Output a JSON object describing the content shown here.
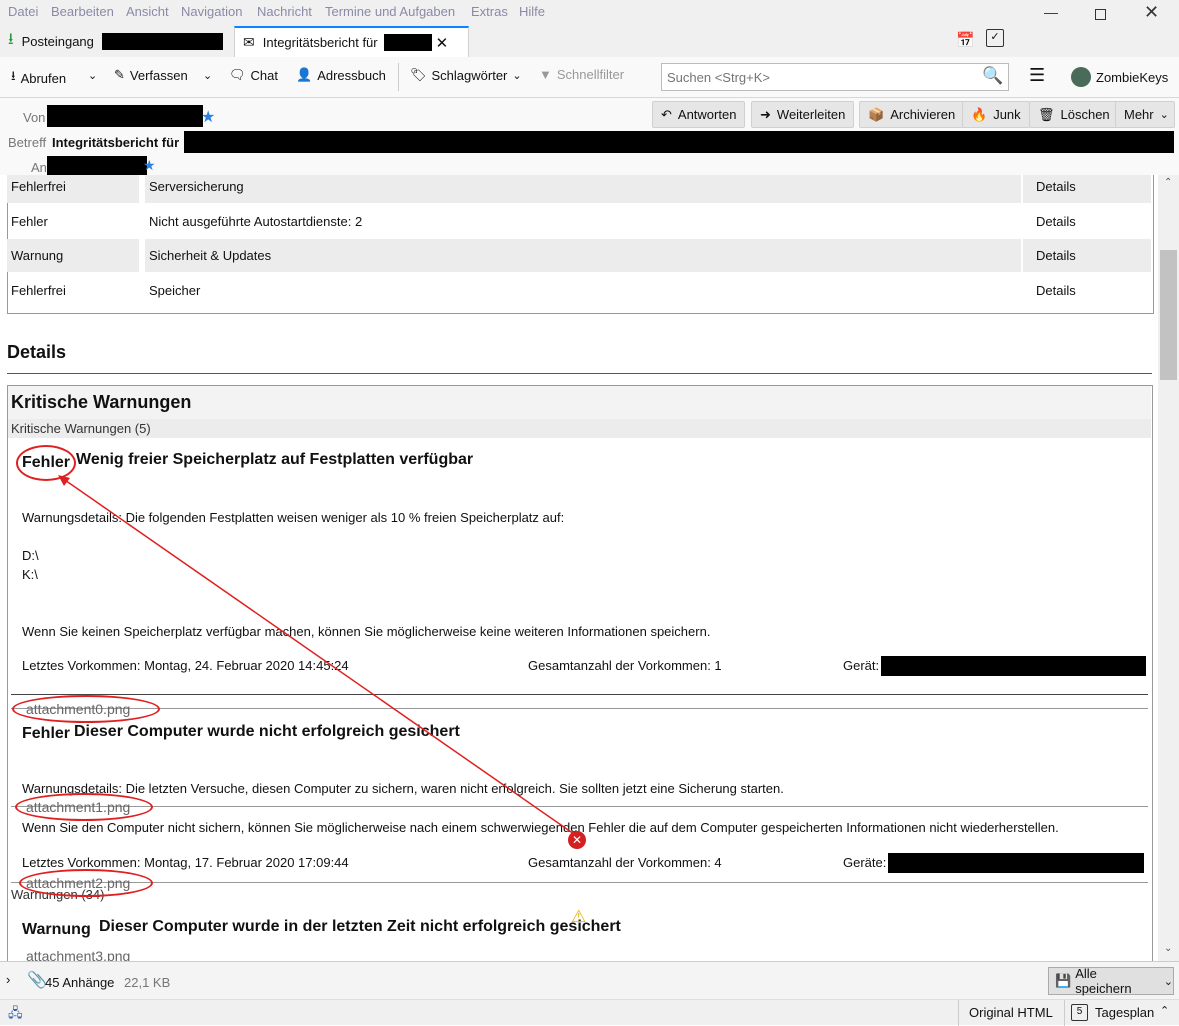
{
  "menu": [
    "Datei",
    "Bearbeiten",
    "Ansicht",
    "Navigation",
    "Nachricht",
    "Termine und Aufgaben",
    "Extras",
    "Hilfe"
  ],
  "tabs": [
    {
      "label": "Posteingang"
    },
    {
      "label": "Integritätsbericht für"
    }
  ],
  "toolbar": {
    "fetch": "Abrufen",
    "compose": "Verfassen",
    "chat": "Chat",
    "addressbook": "Adressbuch",
    "tags": "Schlagwörter",
    "quickfilter": "Schnellfilter",
    "search_placeholder": "Suchen <Strg+K>",
    "account": "ZombieKeys"
  },
  "header": {
    "from_label": "Von",
    "subject_label": "Betreff",
    "subject": "Integritätsbericht für",
    "to_label": "An",
    "buttons": {
      "reply": "Antworten",
      "forward": "Weiterleiten",
      "archive": "Archivieren",
      "junk": "Junk",
      "delete": "Löschen",
      "more": "Mehr"
    }
  },
  "summary_rows": [
    {
      "status": "Fehlerfrei",
      "name": "Serversicherung",
      "link": "Details"
    },
    {
      "status": "Fehler",
      "name": "Nicht ausgeführte Autostartdienste: 2",
      "link": "Details"
    },
    {
      "status": "Warnung",
      "name": "Sicherheit & Updates",
      "link": "Details"
    },
    {
      "status": "Fehlerfrei",
      "name": "Speicher",
      "link": "Details"
    }
  ],
  "details": {
    "heading": "Details",
    "critical_heading": "Kritische Warnungen",
    "critical_count": "Kritische Warnungen (5)",
    "item1": {
      "level": "Fehler",
      "title": "Wenig freier Speicherplatz auf Festplatten verfügbar",
      "details": "Warnungsdetails: Die folgenden Festplatten weisen weniger als 10 % freien Speicherplatz auf:",
      "drive1": "D:\\",
      "drive2": "K:\\",
      "consequence": "Wenn Sie keinen Speicherplatz verfügbar machen, können Sie möglicherweise keine weiteren Informationen speichern.",
      "last": "Letztes Vorkommen: Montag, 24. Februar 2020 14:45:24",
      "total": "Gesamtanzahl der Vorkommen: 1",
      "device": "Gerät:"
    },
    "item2": {
      "level": "Fehler",
      "title": "Dieser Computer wurde nicht erfolgreich gesichert",
      "details": "Warnungsdetails: Die letzten Versuche, diesen Computer zu sichern, waren nicht erfolgreich. Sie sollten jetzt eine Sicherung starten.",
      "consequence": "Wenn Sie den Computer nicht sichern, können Sie möglicherweise nach einem schwerwiegenden Fehler die auf dem Computer gespeicherten Informationen nicht wiederherstellen.",
      "last": "Letztes Vorkommen: Montag, 17. Februar 2020 17:09:44",
      "total": "Gesamtanzahl der Vorkommen: 4",
      "device": "Geräte:"
    },
    "warnings_count": "Warnungen (34)",
    "item3": {
      "level": "Warnung",
      "title": "Dieser Computer wurde in der letzten Zeit nicht erfolgreich gesichert"
    }
  },
  "attachments_inline": [
    "attachment0.png",
    "attachment1.png",
    "attachment2.png",
    "attachment3.png"
  ],
  "attachment_bar": {
    "count": "45 Anhänge",
    "size": "22,1 KB",
    "save_all": "Alle speichern"
  },
  "statusbar": {
    "original_html": "Original HTML",
    "today_pane": "Tagesplan",
    "day": "5"
  },
  "colors": {
    "accent": "#0a84ff",
    "annotation": "#e02020"
  }
}
